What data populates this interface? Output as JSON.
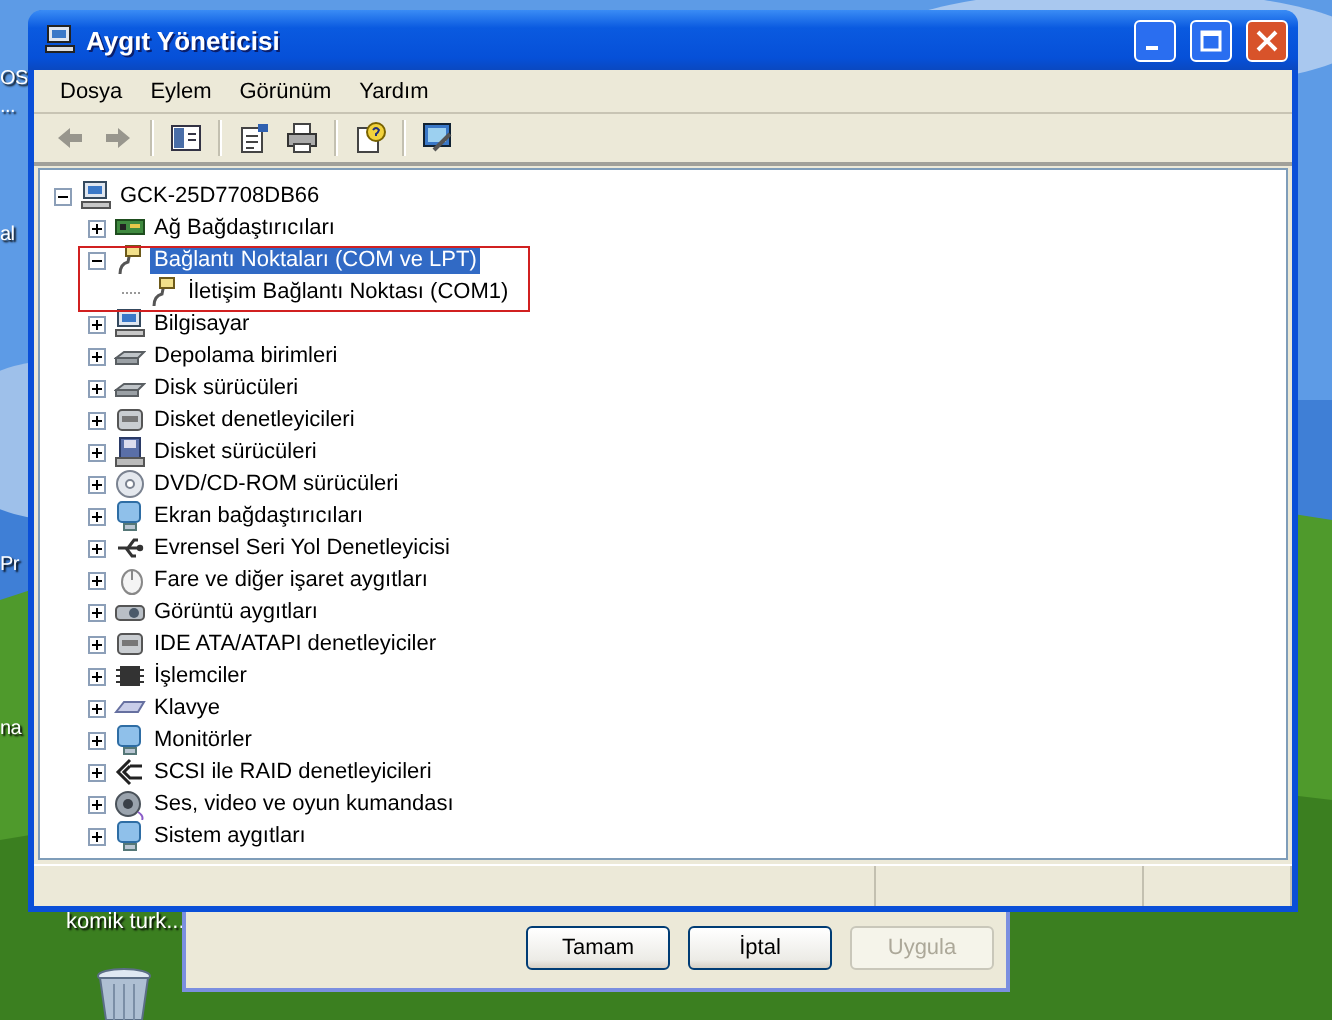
{
  "desktop": {
    "edge_labels": [
      "OS",
      "...",
      "al",
      "Pr",
      "na"
    ],
    "icon_label": "komik turk..."
  },
  "window": {
    "title": "Aygıt Yöneticisi",
    "menu": [
      "Dosya",
      "Eylem",
      "Görünüm",
      "Yardım"
    ],
    "toolbar": [
      {
        "kind": "back",
        "disabled": true
      },
      {
        "kind": "forward",
        "disabled": true
      },
      {
        "kind": "sep"
      },
      {
        "kind": "tree",
        "disabled": false
      },
      {
        "kind": "sep"
      },
      {
        "kind": "properties",
        "disabled": false
      },
      {
        "kind": "print",
        "disabled": false
      },
      {
        "kind": "sep"
      },
      {
        "kind": "help",
        "disabled": false
      },
      {
        "kind": "sep"
      },
      {
        "kind": "scan",
        "disabled": false
      }
    ],
    "tree": {
      "label": "GCK-25D7708DB66",
      "kind": "computer",
      "expanded": true,
      "selected": false,
      "children": [
        {
          "label": "Ağ Bağdaştırıcıları",
          "kind": "card",
          "expanded": false,
          "selected": false
        },
        {
          "label": "Bağlantı Noktaları (COM ve LPT)",
          "kind": "port",
          "expanded": true,
          "selected": true,
          "children": [
            {
              "label": "İletişim Bağlantı Noktası (COM1)",
              "kind": "port",
              "selected": false
            }
          ]
        },
        {
          "label": "Bilgisayar",
          "kind": "computer",
          "expanded": false,
          "selected": false
        },
        {
          "label": "Depolama birimleri",
          "kind": "drive",
          "expanded": false,
          "selected": false
        },
        {
          "label": "Disk sürücüleri",
          "kind": "drive",
          "expanded": false,
          "selected": false
        },
        {
          "label": "Disket denetleyicileri",
          "kind": "controller",
          "expanded": false,
          "selected": false
        },
        {
          "label": "Disket sürücüleri",
          "kind": "floppy",
          "expanded": false,
          "selected": false
        },
        {
          "label": "DVD/CD-ROM sürücüleri",
          "kind": "disc",
          "expanded": false,
          "selected": false
        },
        {
          "label": "Ekran bağdaştırıcıları",
          "kind": "monitor",
          "expanded": false,
          "selected": false
        },
        {
          "label": "Evrensel Seri Yol Denetleyicisi",
          "kind": "usb",
          "expanded": false,
          "selected": false
        },
        {
          "label": "Fare ve diğer işaret aygıtları",
          "kind": "mouse",
          "expanded": false,
          "selected": false
        },
        {
          "label": "Görüntü aygıtları",
          "kind": "camera",
          "expanded": false,
          "selected": false
        },
        {
          "label": "IDE ATA/ATAPI denetleyiciler",
          "kind": "controller",
          "expanded": false,
          "selected": false
        },
        {
          "label": "İşlemciler",
          "kind": "chip",
          "expanded": false,
          "selected": false
        },
        {
          "label": "Klavye",
          "kind": "keyboard",
          "expanded": false,
          "selected": false
        },
        {
          "label": "Monitörler",
          "kind": "monitor",
          "expanded": false,
          "selected": false
        },
        {
          "label": "SCSI ile RAID denetleyicileri",
          "kind": "scsi",
          "expanded": false,
          "selected": false
        },
        {
          "label": "Ses, video ve oyun kumandası",
          "kind": "speaker",
          "expanded": false,
          "selected": false
        },
        {
          "label": "Sistem aygıtları",
          "kind": "monitor",
          "expanded": false,
          "selected": false
        }
      ]
    }
  },
  "dialog": {
    "buttons": [
      {
        "label": "Tamam",
        "disabled": false
      },
      {
        "label": "İptal",
        "disabled": false
      },
      {
        "label": "Uygula",
        "disabled": true
      }
    ]
  }
}
